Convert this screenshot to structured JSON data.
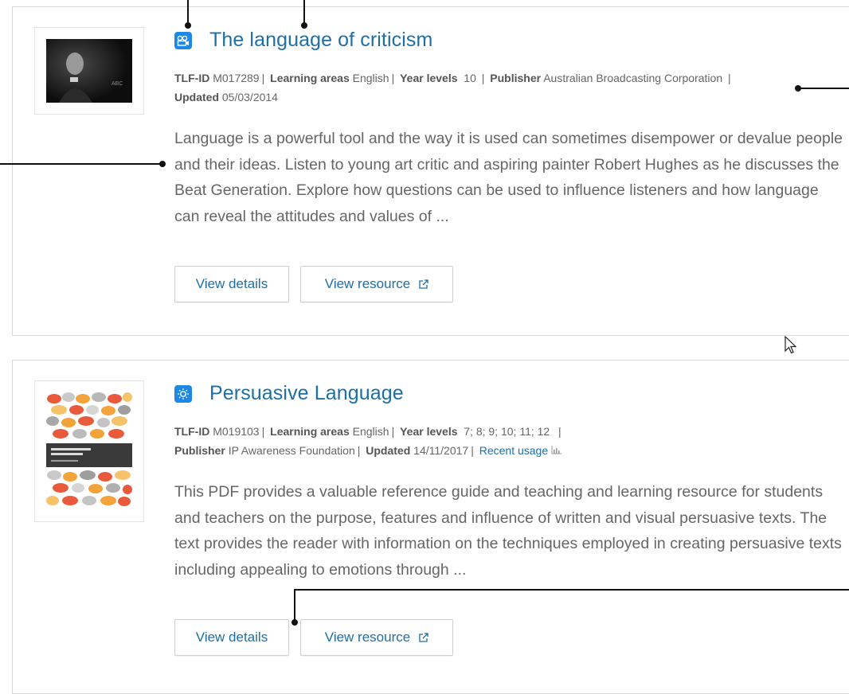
{
  "results": [
    {
      "type_icon": "video-camera-icon",
      "title": "The language of criticism",
      "meta": {
        "tlf_id_label": "TLF-ID",
        "tlf_id": "M017289",
        "learning_areas_label": "Learning areas",
        "learning_areas": "English",
        "year_levels_label": "Year levels",
        "year_levels": "10",
        "publisher_label": "Publisher",
        "publisher": "Australian Broadcasting Corporation",
        "updated_label": "Updated",
        "updated": "05/03/2014"
      },
      "description": "Language is a powerful tool and the way it is used can sometimes disempower or devalue people and their ideas. Listen to young art critic and aspiring painter Robert Hughes as he discusses the Beat Generation. Explore how questions can be used to influence listeners and how language can reveal the attitudes and values of ...",
      "buttons": {
        "details": "View details",
        "resource": "View resource"
      }
    },
    {
      "type_icon": "lightbulb-icon",
      "title": "Persuasive Language",
      "meta": {
        "tlf_id_label": "TLF-ID",
        "tlf_id": "M019103",
        "learning_areas_label": "Learning areas",
        "learning_areas": "English",
        "year_levels_label": "Year levels",
        "year_levels": "7; 8; 9; 10; 11; 12",
        "publisher_label": "Publisher",
        "publisher": "IP Awareness Foundation",
        "updated_label": "Updated",
        "updated": "14/11/2017",
        "recent_usage": "Recent usage"
      },
      "description": "This PDF provides a valuable reference guide and teaching and learning resource for students and teachers on the purpose, features and influence of written and visual persuasive texts. The text provides the reader with information on the techniques employed in creating persuasive texts including appealing to emotions through ...",
      "buttons": {
        "details": "View details",
        "resource": "View resource"
      }
    }
  ],
  "colors": {
    "accent": "#1d6fa5",
    "icon_bg": "#1e88e5",
    "border": "#d9d9d9"
  }
}
